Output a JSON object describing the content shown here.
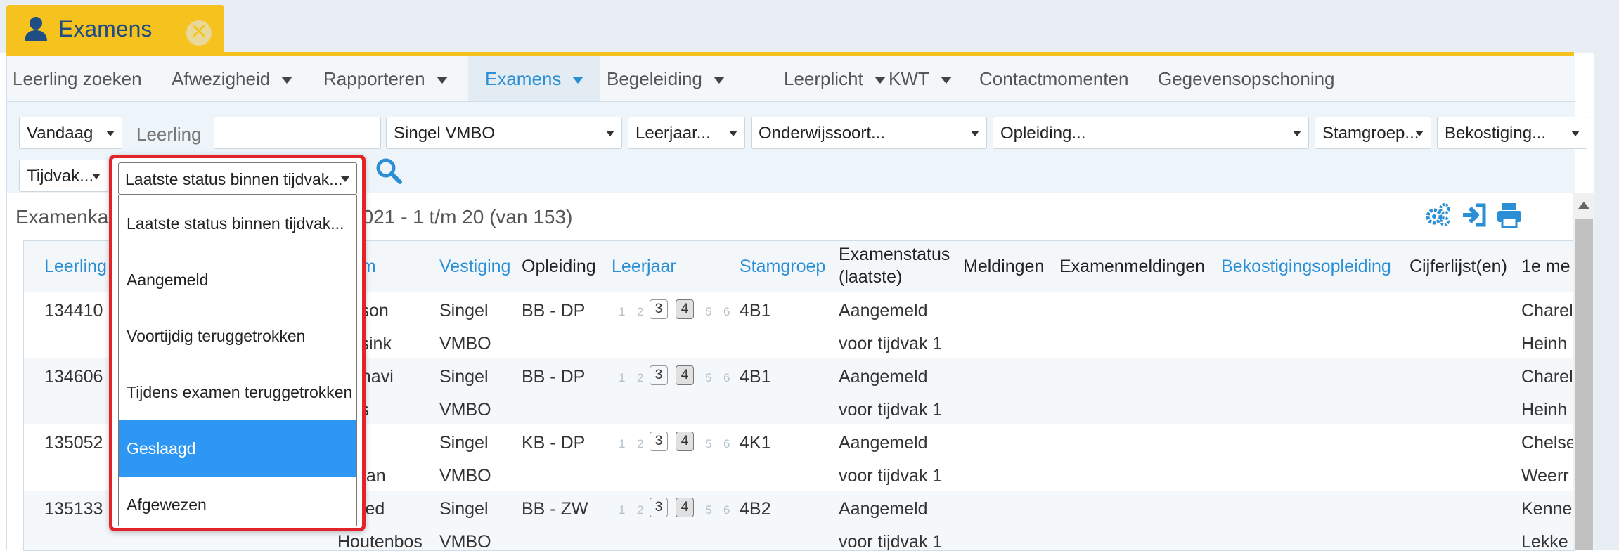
{
  "app_tab": {
    "title": "Examens",
    "close_icon": "close-icon",
    "user_icon": "person-icon",
    "close_glyph": "✕"
  },
  "menu": [
    {
      "label": "Leerling zoeken",
      "has_caret": false
    },
    {
      "label": "Afwezigheid",
      "has_caret": true
    },
    {
      "label": "Rapporteren",
      "has_caret": true
    },
    {
      "label": "Examens",
      "has_caret": true,
      "active": true
    },
    {
      "label": "Begeleiding",
      "has_caret": true
    },
    {
      "label": "Leerplicht",
      "has_caret": true
    },
    {
      "label": "KWT",
      "has_caret": true
    },
    {
      "label": "Contactmomenten",
      "has_caret": false
    },
    {
      "label": "Gegevensopschoning",
      "has_caret": false
    }
  ],
  "filters": {
    "date": "Vandaag",
    "leerling_label": "Leerling",
    "leerling_value": "",
    "vestiging": "Singel VMBO",
    "leerjaar": "Leerjaar...",
    "onderwijssoort": "Onderwijssoort...",
    "opleiding": "Opleiding...",
    "stamgroep": "Stamgroep...",
    "bekostiging": "Bekostiging...",
    "tijdvak": "Tijdvak...",
    "status": "Laatste status binnen tijdvak..."
  },
  "content": {
    "subtitle_left": "Examenka",
    "subtitle_right": "2021 - 1 t/m 20 (van 153)"
  },
  "columns": [
    {
      "label": "Leerling",
      "link": true
    },
    {
      "label": "am",
      "link": true
    },
    {
      "label": "Vestiging",
      "link": true
    },
    {
      "label": "Opleiding",
      "link": false
    },
    {
      "label": "Leerjaar",
      "link": true
    },
    {
      "label": "Stamgroep",
      "link": true
    },
    {
      "label": "Examenstatus",
      "label2": "(laatste)",
      "link": false
    },
    {
      "label": "Meldingen",
      "link": false
    },
    {
      "label": "Examenmeldingen",
      "link": false
    },
    {
      "label": "Bekostigingsopleiding",
      "link": true
    },
    {
      "label": "Cijferlijst(en)",
      "link": false
    },
    {
      "label": "1e me",
      "link": false
    }
  ],
  "rows": [
    {
      "id": "134410",
      "name1": "kson",
      "name2": "ssink",
      "vest1": "Singel",
      "vest2": "VMBO",
      "opl": "BB - DP",
      "leerjaar": 4,
      "stamgroep": "4B1",
      "status1": "Aangemeld",
      "status2": "voor tijdvak 1",
      "meld1": "Charel",
      "meld2": "Heinh"
    },
    {
      "id": "134606",
      "name1": "dhavi",
      "name2": "ks",
      "vest1": "Singel",
      "vest2": "VMBO",
      "opl": "BB - DP",
      "leerjaar": 4,
      "stamgroep": "4B1",
      "status1": "Aangemeld",
      "status2": "voor tijdvak 1",
      "meld1": "Charel",
      "meld2": "Heinh"
    },
    {
      "id": "135052",
      "name1": "a",
      "name2": "man",
      "vest1": "Singel",
      "vest2": "VMBO",
      "opl": "KB - DP",
      "leerjaar": 4,
      "stamgroep": "4K1",
      "status1": "Aangemeld",
      "status2": "voor tijdvak 1",
      "meld1": "Chelse",
      "meld2": "Weerr"
    },
    {
      "id": "135133",
      "name1": "eled",
      "name2": "Houtenbos",
      "vest1": "Singel",
      "vest2": "VMBO",
      "opl": "BB - ZW",
      "leerjaar": 4,
      "stamgroep": "4B2",
      "status1": "Aangemeld",
      "status2": "voor tijdvak 1",
      "meld1": "Kenne",
      "meld2": "Lekke"
    }
  ],
  "leerjaar_options": [
    "1",
    "2",
    "3",
    "4",
    "5",
    "6"
  ],
  "dropdown": {
    "selected": "Laatste status binnen tijdvak...",
    "options": [
      "Laatste status binnen tijdvak...",
      "Aangemeld",
      "Voortijdig teruggetrokken",
      "Tijdens examen teruggetrokken",
      "Geslaagd",
      "Afgewezen"
    ],
    "highlighted_index": 4
  },
  "colors": {
    "accent": "#2b8fd6",
    "tab_yellow": "#f6c21d",
    "highlight": "#2e96f3",
    "focus_ring": "#e0242a"
  }
}
